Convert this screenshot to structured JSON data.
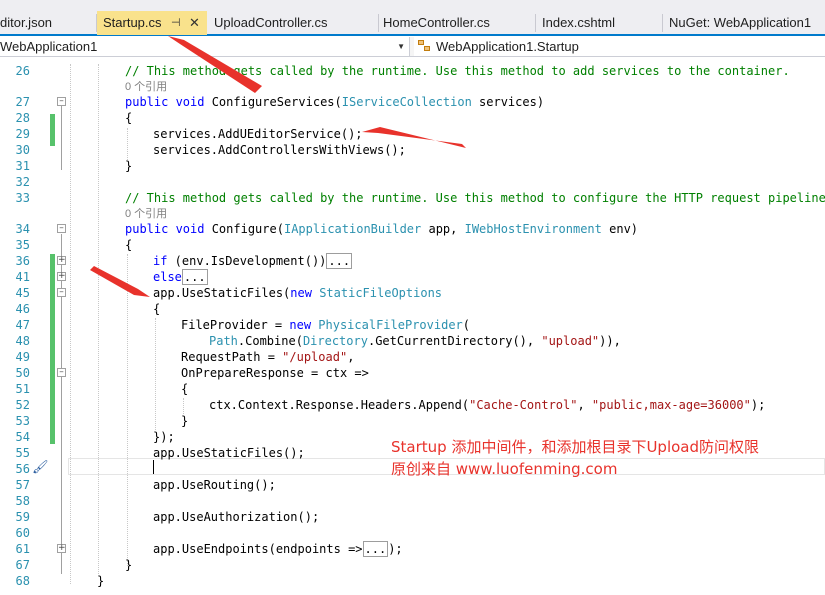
{
  "tabs": [
    {
      "label": "ditor.json"
    },
    {
      "label": "Startup.cs",
      "active": true
    },
    {
      "label": "UploadController.cs"
    },
    {
      "label": "HomeController.cs"
    },
    {
      "label": "Index.cshtml"
    },
    {
      "label": "NuGet: WebApplication1"
    }
  ],
  "tab_pin_glyph": "⊣",
  "tab_close_glyph": "✕",
  "nav": {
    "project": "WebApplication1",
    "class": "WebApplication1.Startup"
  },
  "refs": {
    "ref_label": "0 个引用"
  },
  "gutter_numbers": [
    "26",
    "27",
    "28",
    "29",
    "30",
    "31",
    "32",
    "33",
    "34",
    "35",
    "36",
    "41",
    "45",
    "46",
    "47",
    "48",
    "49",
    "50",
    "51",
    "52",
    "53",
    "54",
    "55",
    "56",
    "57",
    "58",
    "59",
    "60",
    "61",
    "67",
    "68"
  ],
  "code": {
    "l26": "// This method gets called by the runtime. Use this method to add services to the container.",
    "l27_kw": "public void",
    "l27_name": " ConfigureServices(",
    "l27_type": "IServiceCollection",
    "l27_rest": " services)",
    "l28": "{",
    "l29": "services.AddUEditorService();",
    "l30": "services.AddControllersWithViews();",
    "l31": "}",
    "l33": "// This method gets called by the runtime. Use this method to configure the HTTP request pipeline.",
    "l34_kw": "public void",
    "l34_name": " Configure(",
    "l34_type1": "IApplicationBuilder",
    "l34_mid": " app, ",
    "l34_type2": "IWebHostEnvironment",
    "l34_rest": " env)",
    "l35": "{",
    "l36_kw": "if",
    "l36_rest": " (env.IsDevelopment())",
    "l41_kw": "else",
    "collapsed": "...",
    "l45_a": "app.UseStaticFiles(",
    "l45_kw": "new",
    "l45_type": " StaticFileOptions",
    "l46": "{",
    "l47_a": "FileProvider = ",
    "l47_kw": "new",
    "l47_type": " PhysicalFileProvider",
    "l47_b": "(",
    "l48_type1": "Path",
    "l48_a": ".Combine(",
    "l48_type2": "Directory",
    "l48_b": ".GetCurrentDirectory(), ",
    "l48_str": "\"upload\"",
    "l48_c": ")),",
    "l49_a": "RequestPath = ",
    "l49_str": "\"/upload\"",
    "l49_b": ",",
    "l50": "OnPrepareResponse = ctx =>",
    "l51": "{",
    "l52_a": "ctx.Context.Response.Headers.Append(",
    "l52_str1": "\"Cache-Control\"",
    "l52_b": ", ",
    "l52_str2": "\"public,max-age=36000\"",
    "l52_c": ");",
    "l53": "}",
    "l54": "});",
    "l55": "app.UseStaticFiles();",
    "l57": "app.UseRouting();",
    "l59": "app.UseAuthorization();",
    "l61_a": "app.UseEndpoints(endpoints =>",
    "l61_b": ");",
    "l67": "}",
    "l68": "}"
  },
  "annotation": {
    "line1": "Startup 添加中间件，和添加根目录下Upload防问权限",
    "line2": "原创来自 www.luofenming.com",
    "color": "#e8322b"
  },
  "colors": {
    "keyword": "#0000ff",
    "type": "#2b91af",
    "comment": "#008000",
    "string": "#a31515",
    "change_bar": "#57c26b",
    "active_tab": "#f9e28c"
  }
}
